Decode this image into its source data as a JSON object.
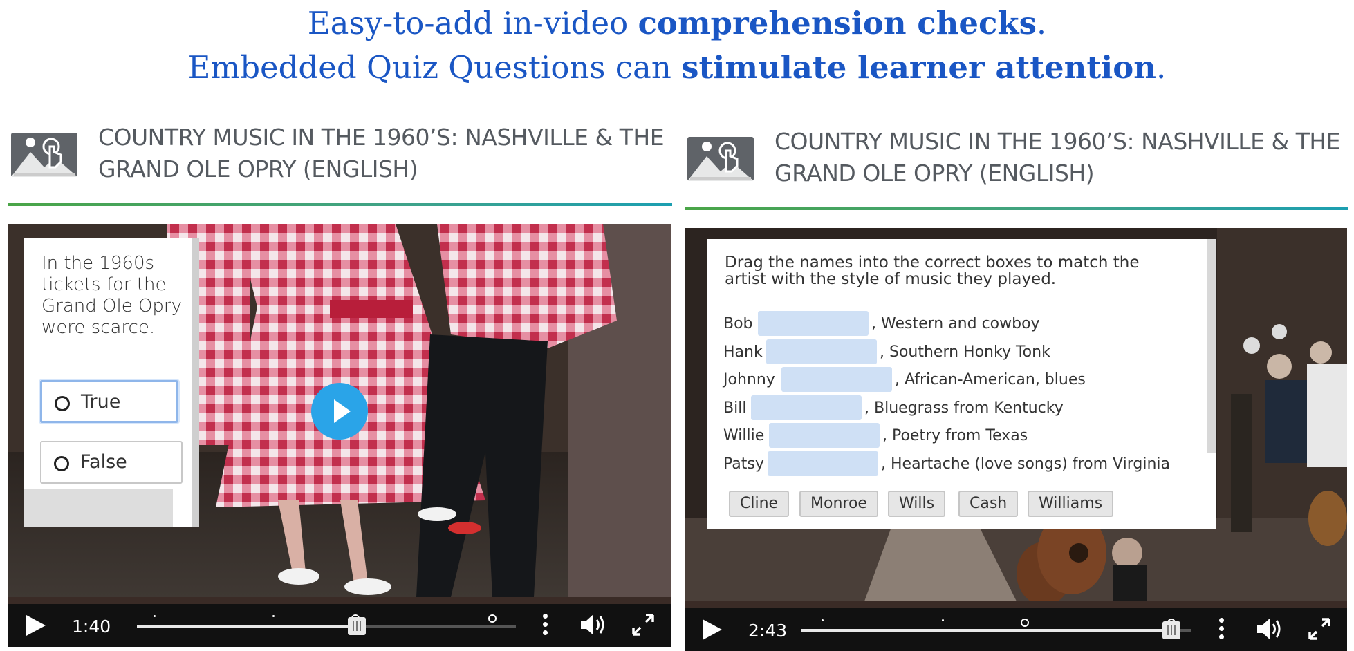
{
  "headline": {
    "line1_pre": "Easy-to-add in-video ",
    "line1_bold": "comprehension checks",
    "line1_post": ".",
    "line2_pre": "Embedded Quiz Questions can ",
    "line2_bold": "stimulate learner attention",
    "line2_post": "."
  },
  "colors": {
    "headline": "#1a56c4",
    "divider_start": "#4aa547",
    "divider_end": "#1c9fb1",
    "play_button": "#2aa4e8",
    "drop_slot": "#cfe0f5"
  },
  "left": {
    "course_title": "COUNTRY MUSIC IN THE 1960’S: NASHVILLE & THE GRAND OLE OPRY (ENGLISH)",
    "course_icon": "interactive-video-icon",
    "question": "In the 1960s tickets for the Grand Ole Opry were scarce.",
    "options": [
      {
        "label": "True",
        "selected": false
      },
      {
        "label": "False",
        "selected": false
      }
    ],
    "time": "1:40",
    "progress": 0.58
  },
  "right": {
    "course_title": "COUNTRY MUSIC IN THE 1960’S: NASHVILLE & THE GRAND OLE OPRY (ENGLISH)",
    "course_icon": "interactive-video-icon",
    "instruction": "Drag the names into the correct boxes to match the artist with the style of music they played.",
    "rows": [
      {
        "name": "Bob",
        "desc": ", Western and cowboy"
      },
      {
        "name": "Hank",
        "desc": ", Southern Honky Tonk"
      },
      {
        "name": "Johnny",
        "desc": ", African-American, blues"
      },
      {
        "name": "Bill",
        "desc": ", Bluegrass from Kentucky"
      },
      {
        "name": "Willie",
        "desc": ", Poetry from Texas"
      },
      {
        "name": "Patsy",
        "desc": ", Heartache (love songs) from Virginia"
      }
    ],
    "choices": [
      "Cline",
      "Monroe",
      "Wills",
      "Cash",
      "Williams"
    ],
    "time": "2:43",
    "progress": 0.95
  }
}
